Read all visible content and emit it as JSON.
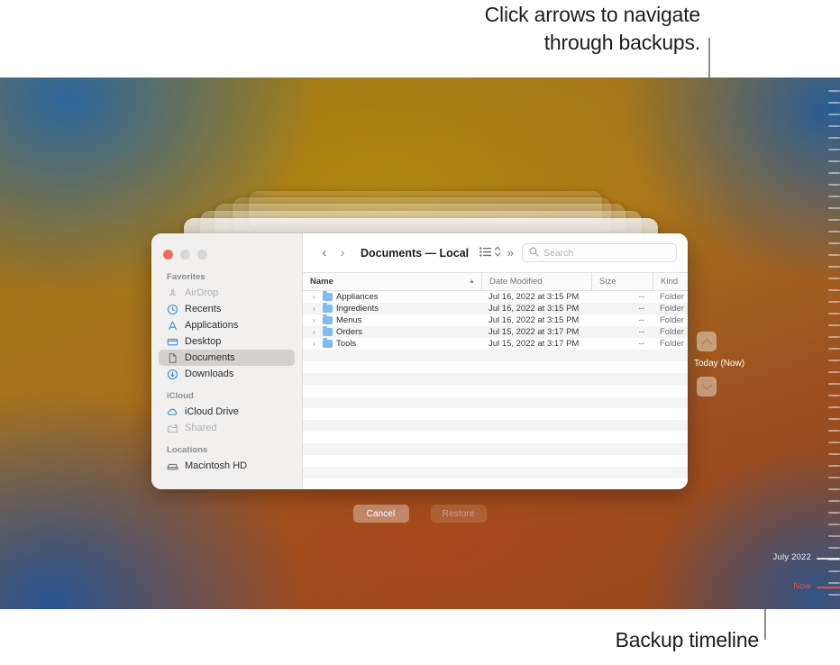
{
  "callouts": {
    "top": "Click arrows to navigate\nthrough backups.",
    "bottom": "Backup timeline"
  },
  "timeline": {
    "current_label": "Today (Now)",
    "month_label": "July 2022",
    "now_label": "Now",
    "up_arrow_icon": "chevron-up-icon",
    "down_arrow_icon": "chevron-down-icon"
  },
  "finder": {
    "title": "Documents — Local",
    "back_icon": "chevron-left-icon",
    "forward_icon": "chevron-right-icon",
    "view_icon": "list-view-icon",
    "arrange_icon": "up-down-chevron-icon",
    "overflow_icon": "double-chevron-right-icon",
    "search": {
      "icon": "search-icon",
      "placeholder": "Search",
      "value": ""
    },
    "traffic_lights": {
      "close": "close-button",
      "minimize": "minimize-button",
      "maximize": "maximize-button"
    },
    "sidebar": {
      "sections": [
        {
          "title": "Favorites",
          "items": [
            {
              "label": "AirDrop",
              "icon": "airdrop-icon",
              "state": "dim"
            },
            {
              "label": "Recents",
              "icon": "clock-icon",
              "state": "normal"
            },
            {
              "label": "Applications",
              "icon": "applications-icon",
              "state": "normal"
            },
            {
              "label": "Desktop",
              "icon": "desktop-icon",
              "state": "normal"
            },
            {
              "label": "Documents",
              "icon": "document-icon",
              "state": "selected"
            },
            {
              "label": "Downloads",
              "icon": "downloads-icon",
              "state": "normal"
            }
          ]
        },
        {
          "title": "iCloud",
          "items": [
            {
              "label": "iCloud Drive",
              "icon": "cloud-icon",
              "state": "normal"
            },
            {
              "label": "Shared",
              "icon": "shared-folder-icon",
              "state": "dim"
            }
          ]
        },
        {
          "title": "Locations",
          "items": [
            {
              "label": "Macintosh HD",
              "icon": "hard-drive-icon",
              "state": "normal"
            }
          ]
        }
      ]
    },
    "columns": [
      {
        "label": "Name",
        "sort": "ascending"
      },
      {
        "label": "Date Modified",
        "sort": "none"
      },
      {
        "label": "Size",
        "sort": "none"
      },
      {
        "label": "Kind",
        "sort": "none"
      }
    ],
    "files": [
      {
        "name": "Appliances",
        "date": "Jul 16, 2022 at 3:15 PM",
        "size": "--",
        "kind": "Folder"
      },
      {
        "name": "Ingredients",
        "date": "Jul 16, 2022 at 3:15 PM",
        "size": "--",
        "kind": "Folder"
      },
      {
        "name": "Menus",
        "date": "Jul 16, 2022 at 3:15 PM",
        "size": "--",
        "kind": "Folder"
      },
      {
        "name": "Orders",
        "date": "Jul 15, 2022 at 3:17 PM",
        "size": "--",
        "kind": "Folder"
      },
      {
        "name": "Tools",
        "date": "Jul 15, 2022 at 3:17 PM",
        "size": "--",
        "kind": "Folder"
      }
    ]
  },
  "actions": {
    "cancel_label": "Cancel",
    "restore_label": "Restore"
  },
  "colors": {
    "accent_red": "#e8503a",
    "folder_blue": "#7fbdf0",
    "close_button": "#ed6a5e",
    "selection_gray": "#d3d1cd"
  }
}
